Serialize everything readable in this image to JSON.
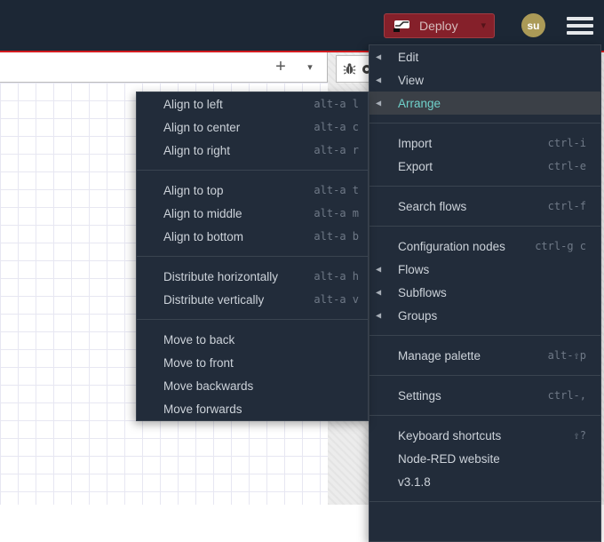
{
  "colors": {
    "header_bg": "#1c2735",
    "accent_red": "#d21b1f",
    "deploy_bg": "#85202a",
    "avatar_bg": "#ab9a57",
    "menu_bg": "#222c3a",
    "menu_highlight": "#3b4047",
    "menu_active_text": "#6fd1cb"
  },
  "header": {
    "deploy_label": "Deploy",
    "deploy_caret_icon": "▾",
    "avatar_initials": "su"
  },
  "tabbar": {
    "add_flow_icon": "+",
    "dropdown_icon": "▾"
  },
  "menus": {
    "main": {
      "groups": [
        {
          "items": [
            {
              "label": "Edit",
              "submenu": true
            },
            {
              "label": "View",
              "submenu": true
            },
            {
              "label": "Arrange",
              "submenu": true,
              "active": true
            }
          ]
        },
        {
          "items": [
            {
              "label": "Import",
              "shortcut": "ctrl-i"
            },
            {
              "label": "Export",
              "shortcut": "ctrl-e"
            }
          ]
        },
        {
          "items": [
            {
              "label": "Search flows",
              "shortcut": "ctrl-f"
            }
          ]
        },
        {
          "items": [
            {
              "label": "Configuration nodes",
              "shortcut": "ctrl-g c"
            },
            {
              "label": "Flows",
              "submenu": true
            },
            {
              "label": "Subflows",
              "submenu": true
            },
            {
              "label": "Groups",
              "submenu": true
            }
          ]
        },
        {
          "items": [
            {
              "label": "Manage palette",
              "shortcut": "alt-⇧p"
            }
          ]
        },
        {
          "items": [
            {
              "label": "Settings",
              "shortcut": "ctrl-,"
            }
          ]
        },
        {
          "items": [
            {
              "label": "Keyboard shortcuts",
              "shortcut": "⇧?"
            },
            {
              "label": "Node-RED website"
            },
            {
              "label": "v3.1.8"
            }
          ]
        }
      ],
      "trailing_separator": true
    },
    "arrange": {
      "groups": [
        {
          "items": [
            {
              "label": "Align to left",
              "shortcut": "alt-a l"
            },
            {
              "label": "Align to center",
              "shortcut": "alt-a c"
            },
            {
              "label": "Align to right",
              "shortcut": "alt-a r"
            }
          ]
        },
        {
          "items": [
            {
              "label": "Align to top",
              "shortcut": "alt-a t"
            },
            {
              "label": "Align to middle",
              "shortcut": "alt-a m"
            },
            {
              "label": "Align to bottom",
              "shortcut": "alt-a b"
            }
          ]
        },
        {
          "items": [
            {
              "label": "Distribute horizontally",
              "shortcut": "alt-a h"
            },
            {
              "label": "Distribute vertically",
              "shortcut": "alt-a v"
            }
          ]
        },
        {
          "items": [
            {
              "label": "Move to back"
            },
            {
              "label": "Move to front"
            },
            {
              "label": "Move backwards"
            },
            {
              "label": "Move forwards"
            }
          ]
        }
      ],
      "trailing_separator": false
    }
  }
}
